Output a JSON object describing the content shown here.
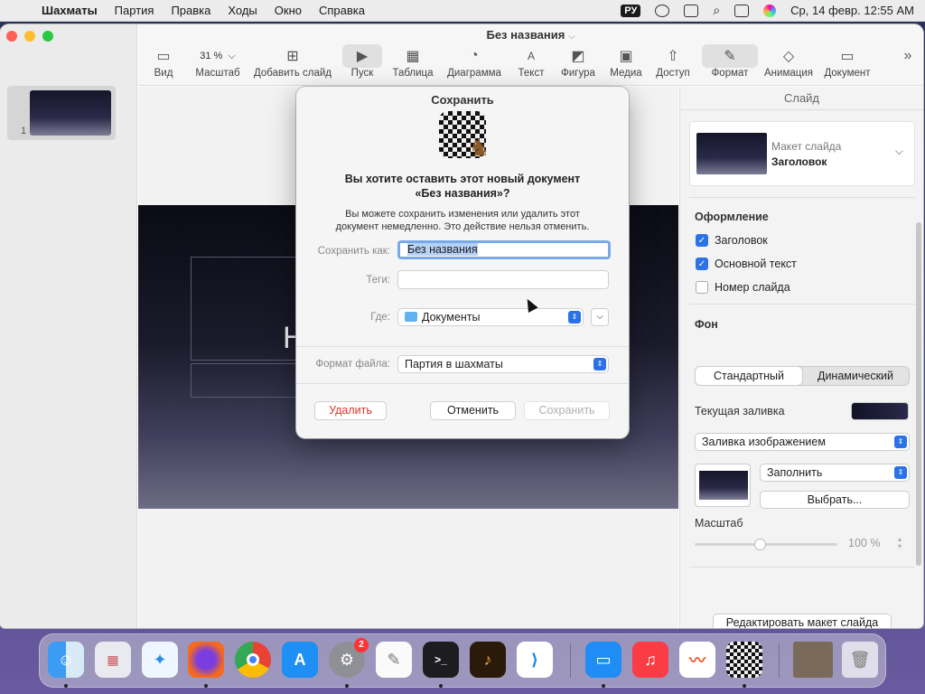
{
  "menubar": {
    "app": "Шахматы",
    "items": [
      "Партия",
      "Правка",
      "Ходы",
      "Окно",
      "Справка"
    ],
    "input_source": "РУ",
    "datetime": "Ср, 14 февр.  12:55 AM"
  },
  "window": {
    "doc_title": "Без названия",
    "slide_number": "1",
    "slide_letter": "Н"
  },
  "toolbar": {
    "view": "Вид",
    "zoom_value": "31 %",
    "zoom": "Масштаб",
    "add_slide": "Добавить слайд",
    "play": "Пуск",
    "table": "Таблица",
    "chart": "Диаграмма",
    "text": "Текст",
    "shape": "Фигура",
    "media": "Медиа",
    "share": "Доступ",
    "format": "Формат",
    "animate": "Анимация",
    "document": "Документ"
  },
  "inspector": {
    "title": "Слайд",
    "layout_label": "Макет слайда",
    "layout_value": "Заголовок",
    "appearance": "Оформление",
    "chk_title": "Заголовок",
    "chk_body": "Основной текст",
    "chk_slide_num": "Номер слайда",
    "chk_title_on": true,
    "chk_body_on": true,
    "chk_slide_num_on": false,
    "background": "Фон",
    "seg_standard": "Стандартный",
    "seg_dynamic": "Динамический",
    "current_fill": "Текущая заливка",
    "fill_type": "Заливка изображением",
    "fill_mode": "Заполнить",
    "choose": "Выбрать...",
    "scale": "Масштаб",
    "scale_value": "100 %",
    "scale_fraction": 0.44,
    "edit_layout": "Редактировать макет слайда"
  },
  "dialog": {
    "title": "Сохранить",
    "heading_1": "Вы хотите оставить этот новый документ",
    "heading_2": "«Без названия»?",
    "body_1": "Вы можете сохранить изменения или удалить этот",
    "body_2": "документ немедленно. Это действие нельзя отменить.",
    "save_as_label": "Сохранить как:",
    "save_as_value": "Без названия",
    "tags_label": "Теги:",
    "where_label": "Где:",
    "where_value": "Документы",
    "format_label": "Формат файла:",
    "format_value": "Партия в шахматы",
    "delete": "Удалить",
    "cancel": "Отменить",
    "save": "Сохранить"
  },
  "dock": {
    "settings_badge": "2",
    "icons": [
      "finder-icon",
      "launchpad-icon",
      "safari-icon",
      "firefox-icon",
      "chrome-icon",
      "app-store-icon",
      "system-settings-icon",
      "textedit-icon",
      "terminal-icon",
      "garageband-icon",
      "vscode-icon",
      "keynote-icon",
      "music-icon",
      "freeform-icon",
      "chess-icon",
      "chess-window-icon",
      "trash-icon"
    ]
  },
  "colors": {
    "accent": "#2b72e6",
    "danger": "#e0352b",
    "selection": "#b5d1f5"
  }
}
